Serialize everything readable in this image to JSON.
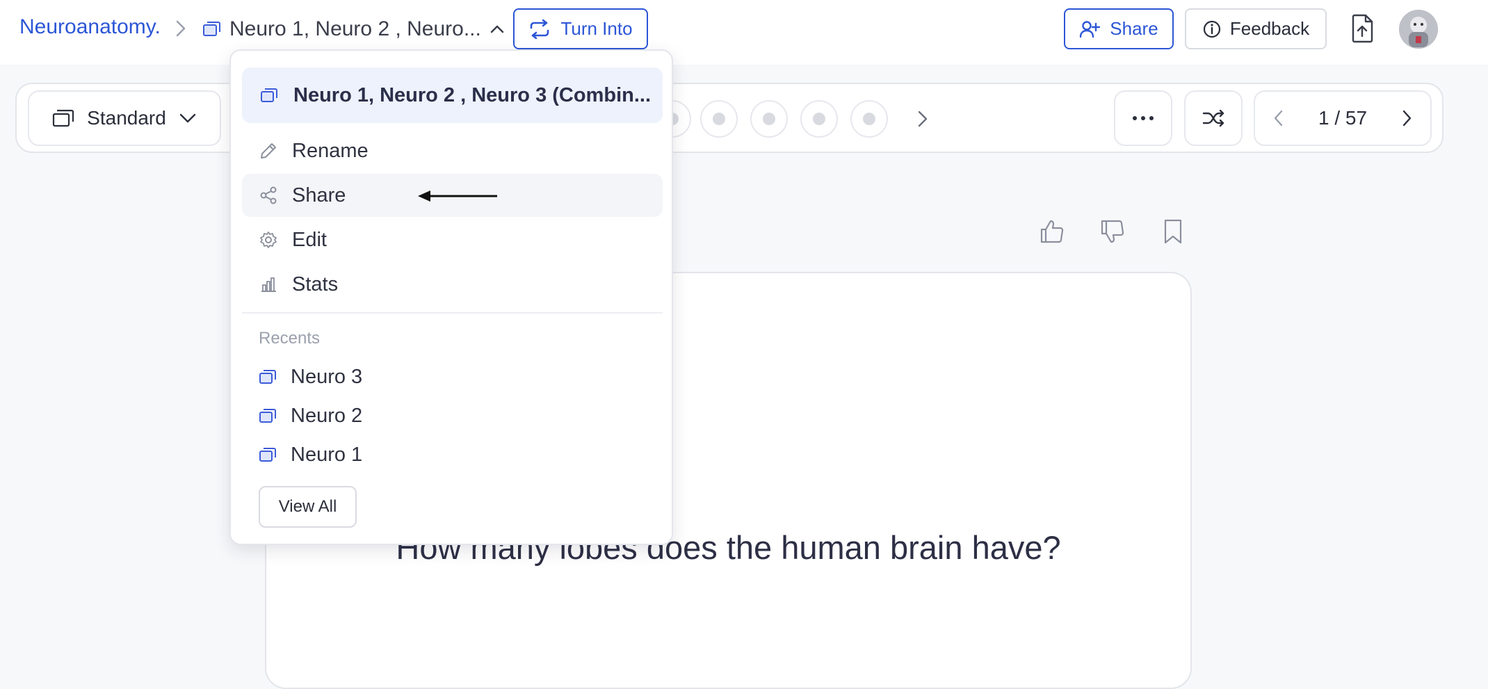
{
  "breadcrumb": {
    "root": "Neuroanatomy.",
    "deck_title": "Neuro 1, Neuro 2 , Neuro..."
  },
  "header": {
    "turn_into_label": "Turn Into",
    "share_label": "Share",
    "feedback_label": "Feedback"
  },
  "toolbar": {
    "mode_label": "Standard",
    "page_indicator": "1 / 57"
  },
  "dropdown": {
    "current_deck": "Neuro 1, Neuro 2 , Neuro 3 (Combin...",
    "actions": [
      {
        "label": "Rename",
        "icon": "pencil-icon"
      },
      {
        "label": "Share",
        "icon": "share-icon"
      },
      {
        "label": "Edit",
        "icon": "gear-icon"
      },
      {
        "label": "Stats",
        "icon": "bar-chart-icon"
      }
    ],
    "recents_title": "Recents",
    "recents": [
      "Neuro 3",
      "Neuro 2",
      "Neuro 1"
    ],
    "view_all_label": "View All"
  },
  "card": {
    "question": "How many lobes does the human brain have?"
  },
  "colors": {
    "accent": "#2c56d6",
    "menu_highlight": "#eef2fc",
    "hover": "#f4f5f8"
  }
}
